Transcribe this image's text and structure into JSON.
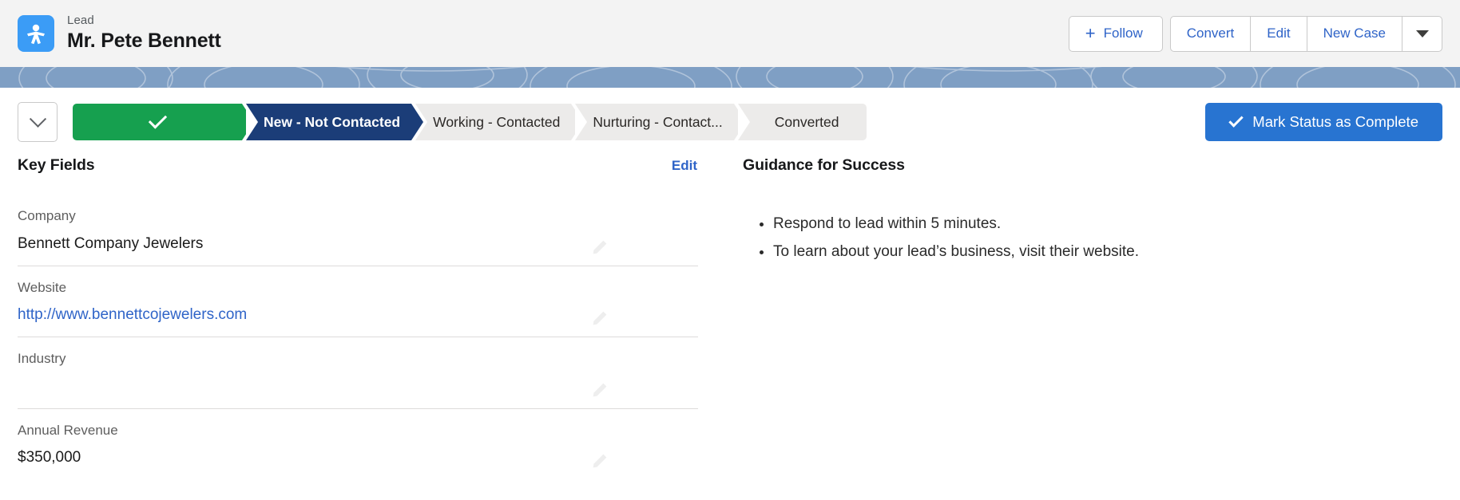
{
  "header": {
    "object_type": "Lead",
    "record_name": "Mr. Pete Bennett",
    "icon": "lead-person-icon",
    "icon_color": "#3b9cf6",
    "actions": {
      "follow_label": "Follow",
      "follow_icon": "plus-icon",
      "convert_label": "Convert",
      "edit_label": "Edit",
      "new_case_label": "New Case",
      "more_icon": "caret-down-icon"
    }
  },
  "path": {
    "toggle_icon": "chevron-down-icon",
    "steps": [
      {
        "label": "",
        "state": "complete",
        "icon": "check-icon"
      },
      {
        "label": "New - Not Contacted",
        "state": "current"
      },
      {
        "label": "Working - Contacted",
        "state": "incomplete"
      },
      {
        "label": "Nurturing - Contact...",
        "state": "incomplete"
      },
      {
        "label": "Converted",
        "state": "incomplete"
      }
    ],
    "mark_complete_label": "Mark Status as Complete",
    "mark_complete_icon": "check-icon",
    "accent_complete": "#16a04f",
    "accent_current": "#1b3d78",
    "accent_button": "#2874d1"
  },
  "key_fields": {
    "title": "Key Fields",
    "edit_label": "Edit",
    "fields": [
      {
        "label": "Company",
        "value": "Bennett Company Jewelers",
        "is_link": false,
        "edit_icon": "pencil-icon"
      },
      {
        "label": "Website",
        "value": "http://www.bennettcojewelers.com",
        "is_link": true,
        "edit_icon": "pencil-icon"
      },
      {
        "label": "Industry",
        "value": "",
        "is_link": false,
        "edit_icon": "pencil-icon"
      },
      {
        "label": "Annual Revenue",
        "value": "$350,000",
        "is_link": false,
        "edit_icon": "pencil-icon"
      }
    ]
  },
  "guidance": {
    "title": "Guidance for Success",
    "items": [
      "Respond to lead within 5 minutes.",
      "To learn about your lead’s business, visit their website."
    ]
  }
}
